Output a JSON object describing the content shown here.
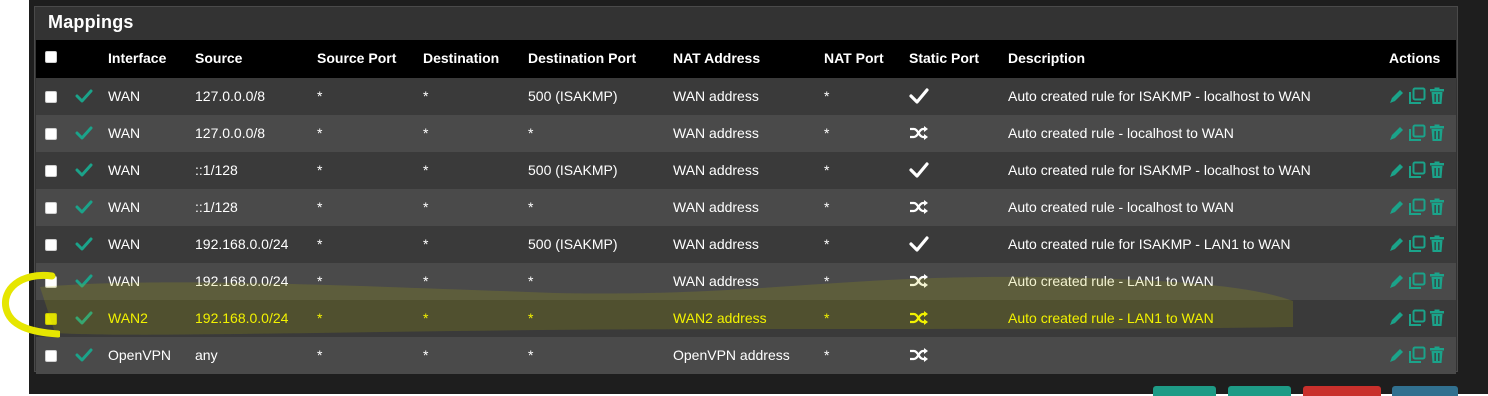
{
  "panel": {
    "title": "Mappings"
  },
  "columns": {
    "interface": "Interface",
    "source": "Source",
    "source_port": "Source Port",
    "destination": "Destination",
    "destination_port": "Destination Port",
    "nat_address": "NAT Address",
    "nat_port": "NAT Port",
    "static_port": "Static Port",
    "description": "Description",
    "actions": "Actions"
  },
  "rows": [
    {
      "interface": "WAN",
      "source": "127.0.0.0/8",
      "source_port": "*",
      "destination": "*",
      "destination_port": "500 (ISAKMP)",
      "nat_address": "WAN address",
      "nat_port": "*",
      "static_port_icon": "check-icon",
      "description": "Auto created rule for ISAKMP - localhost to WAN",
      "highlighted": false
    },
    {
      "interface": "WAN",
      "source": "127.0.0.0/8",
      "source_port": "*",
      "destination": "*",
      "destination_port": "*",
      "nat_address": "WAN address",
      "nat_port": "*",
      "static_port_icon": "shuffle-icon",
      "description": "Auto created rule - localhost to WAN",
      "highlighted": false
    },
    {
      "interface": "WAN",
      "source": "::1/128",
      "source_port": "*",
      "destination": "*",
      "destination_port": "500 (ISAKMP)",
      "nat_address": "WAN address",
      "nat_port": "*",
      "static_port_icon": "check-icon",
      "description": "Auto created rule for ISAKMP - localhost to WAN",
      "highlighted": false
    },
    {
      "interface": "WAN",
      "source": "::1/128",
      "source_port": "*",
      "destination": "*",
      "destination_port": "*",
      "nat_address": "WAN address",
      "nat_port": "*",
      "static_port_icon": "shuffle-icon",
      "description": "Auto created rule - localhost to WAN",
      "highlighted": false
    },
    {
      "interface": "WAN",
      "source": "192.168.0.0/24",
      "source_port": "*",
      "destination": "*",
      "destination_port": "500 (ISAKMP)",
      "nat_address": "WAN address",
      "nat_port": "*",
      "static_port_icon": "check-icon",
      "description": "Auto created rule for ISAKMP - LAN1 to WAN",
      "highlighted": false
    },
    {
      "interface": "WAN",
      "source": "192.168.0.0/24",
      "source_port": "*",
      "destination": "*",
      "destination_port": "*",
      "nat_address": "WAN address",
      "nat_port": "*",
      "static_port_icon": "shuffle-icon",
      "description": "Auto created rule - LAN1 to WAN",
      "highlighted": false
    },
    {
      "interface": "WAN2",
      "source": "192.168.0.0/24",
      "source_port": "*",
      "destination": "*",
      "destination_port": "*",
      "nat_address": "WAN2 address",
      "nat_port": "*",
      "static_port_icon": "shuffle-icon",
      "description": "Auto created rule - LAN1 to WAN",
      "highlighted": true
    },
    {
      "interface": "OpenVPN",
      "source": "any",
      "source_port": "*",
      "destination": "*",
      "destination_port": "*",
      "nat_address": "OpenVPN address",
      "nat_port": "*",
      "static_port_icon": "shuffle-icon",
      "description": "",
      "highlighted": false
    }
  ],
  "colors": {
    "enabled_check": "#1ba38a",
    "action_icon": "#1ba38a",
    "highlight_text": "#ffff00",
    "highlight_marker": "#b8b800"
  },
  "footer_buttons": [
    {
      "icon": "button-teal",
      "color": "#1e9b86"
    },
    {
      "icon": "button-teal",
      "color": "#1e9b86"
    },
    {
      "icon": "button-red",
      "color": "#c9302c"
    },
    {
      "icon": "button-blue",
      "color": "#31708f"
    }
  ]
}
